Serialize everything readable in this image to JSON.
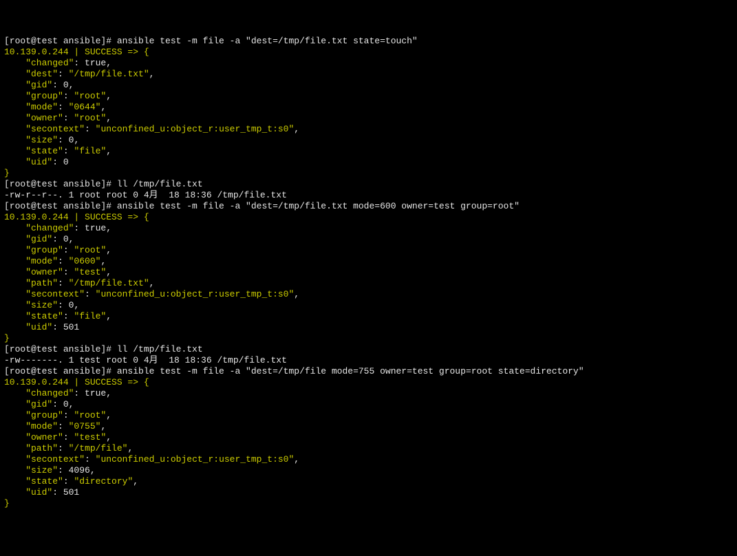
{
  "blocks": [
    {
      "t": "prompt",
      "prompt": "[root@test ansible]# ",
      "cmd": "ansible test -m file -a \"dest=/tmp/file.txt state=touch\""
    },
    {
      "t": "yline",
      "text": "10.139.0.244 | SUCCESS => {"
    },
    {
      "t": "kv_raw",
      "k": "    \"changed\"",
      "v": "true",
      "trail": ","
    },
    {
      "t": "kv_str",
      "k": "    \"dest\"",
      "v": "\"/tmp/file.txt\"",
      "trail": ","
    },
    {
      "t": "kv_raw",
      "k": "    \"gid\"",
      "v": "0",
      "trail": ","
    },
    {
      "t": "kv_str",
      "k": "    \"group\"",
      "v": "\"root\"",
      "trail": ","
    },
    {
      "t": "kv_str",
      "k": "    \"mode\"",
      "v": "\"0644\"",
      "trail": ","
    },
    {
      "t": "kv_str",
      "k": "    \"owner\"",
      "v": "\"root\"",
      "trail": ","
    },
    {
      "t": "kv_str",
      "k": "    \"secontext\"",
      "v": "\"unconfined_u:object_r:user_tmp_t:s0\"",
      "trail": ","
    },
    {
      "t": "kv_raw",
      "k": "    \"size\"",
      "v": "0",
      "trail": ","
    },
    {
      "t": "kv_str",
      "k": "    \"state\"",
      "v": "\"file\"",
      "trail": ","
    },
    {
      "t": "kv_raw",
      "k": "    \"uid\"",
      "v": "0",
      "trail": ""
    },
    {
      "t": "yline",
      "text": "}"
    },
    {
      "t": "prompt",
      "prompt": "[root@test ansible]# ",
      "cmd": "ll /tmp/file.txt"
    },
    {
      "t": "wline",
      "text": "-rw-r--r--. 1 root root 0 4月  18 18:36 /tmp/file.txt"
    },
    {
      "t": "prompt",
      "prompt": "[root@test ansible]# ",
      "cmd": "ansible test -m file -a \"dest=/tmp/file.txt mode=600 owner=test group=root\""
    },
    {
      "t": "yline",
      "text": "10.139.0.244 | SUCCESS => {"
    },
    {
      "t": "kv_raw",
      "k": "    \"changed\"",
      "v": "true",
      "trail": ","
    },
    {
      "t": "kv_raw",
      "k": "    \"gid\"",
      "v": "0",
      "trail": ","
    },
    {
      "t": "kv_str",
      "k": "    \"group\"",
      "v": "\"root\"",
      "trail": ","
    },
    {
      "t": "kv_str",
      "k": "    \"mode\"",
      "v": "\"0600\"",
      "trail": ","
    },
    {
      "t": "kv_str",
      "k": "    \"owner\"",
      "v": "\"test\"",
      "trail": ","
    },
    {
      "t": "kv_str",
      "k": "    \"path\"",
      "v": "\"/tmp/file.txt\"",
      "trail": ","
    },
    {
      "t": "kv_str",
      "k": "    \"secontext\"",
      "v": "\"unconfined_u:object_r:user_tmp_t:s0\"",
      "trail": ","
    },
    {
      "t": "kv_raw",
      "k": "    \"size\"",
      "v": "0",
      "trail": ","
    },
    {
      "t": "kv_str",
      "k": "    \"state\"",
      "v": "\"file\"",
      "trail": ","
    },
    {
      "t": "kv_raw",
      "k": "    \"uid\"",
      "v": "501",
      "trail": ""
    },
    {
      "t": "yline",
      "text": "}"
    },
    {
      "t": "prompt",
      "prompt": "[root@test ansible]# ",
      "cmd": "ll /tmp/file.txt"
    },
    {
      "t": "wline",
      "text": "-rw-------. 1 test root 0 4月  18 18:36 /tmp/file.txt"
    },
    {
      "t": "prompt",
      "prompt": "[root@test ansible]# ",
      "cmd": "ansible test -m file -a \"dest=/tmp/file mode=755 owner=test group=root state=directory\""
    },
    {
      "t": "yline",
      "text": "10.139.0.244 | SUCCESS => {"
    },
    {
      "t": "kv_raw",
      "k": "    \"changed\"",
      "v": "true",
      "trail": ","
    },
    {
      "t": "kv_raw",
      "k": "    \"gid\"",
      "v": "0",
      "trail": ","
    },
    {
      "t": "kv_str",
      "k": "    \"group\"",
      "v": "\"root\"",
      "trail": ","
    },
    {
      "t": "kv_str",
      "k": "    \"mode\"",
      "v": "\"0755\"",
      "trail": ","
    },
    {
      "t": "kv_str",
      "k": "    \"owner\"",
      "v": "\"test\"",
      "trail": ","
    },
    {
      "t": "kv_str",
      "k": "    \"path\"",
      "v": "\"/tmp/file\"",
      "trail": ","
    },
    {
      "t": "kv_str",
      "k": "    \"secontext\"",
      "v": "\"unconfined_u:object_r:user_tmp_t:s0\"",
      "trail": ","
    },
    {
      "t": "kv_raw",
      "k": "    \"size\"",
      "v": "4096",
      "trail": ","
    },
    {
      "t": "kv_str",
      "k": "    \"state\"",
      "v": "\"directory\"",
      "trail": ","
    },
    {
      "t": "kv_raw",
      "k": "    \"uid\"",
      "v": "501",
      "trail": ""
    },
    {
      "t": "yline",
      "text": "}"
    }
  ]
}
